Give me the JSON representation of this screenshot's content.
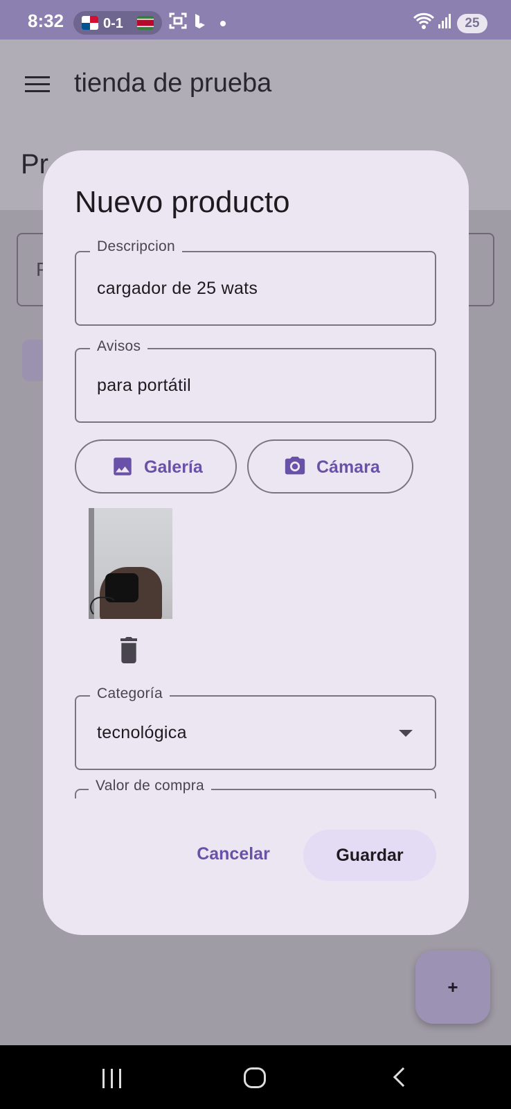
{
  "status_bar": {
    "time": "8:32",
    "score": "0-1",
    "battery": "25",
    "icons": [
      "flag-panama-icon",
      "flag-suriname-icon",
      "screenshot-icon",
      "bing-icon",
      "notification-dot-icon",
      "wifi-icon",
      "signal-icon",
      "battery-icon"
    ]
  },
  "app_bar": {
    "title": "tienda de prueba",
    "menu_icon": "menu-icon"
  },
  "background": {
    "heading": "Pr",
    "field_text": "P"
  },
  "dialog": {
    "title": "Nuevo producto",
    "fields": {
      "descripcion": {
        "label": "Descripcion",
        "value": "cargador de 25 wats"
      },
      "avisos": {
        "label": "Avisos",
        "value": "para portátil"
      },
      "categoria": {
        "label": "Categoría",
        "value": "tecnológica"
      },
      "valor_compra": {
        "label": "Valor de compra"
      }
    },
    "buttons": {
      "galeria": "Galería",
      "camara": "Cámara",
      "cancel": "Cancelar",
      "save": "Guardar"
    }
  },
  "fab": {
    "label": "+"
  },
  "colors": {
    "accent": "#6a51a8",
    "dialog_bg": "#ebe6f1",
    "scrim": "#a09ca6",
    "status_bar": "#8c80b0"
  }
}
